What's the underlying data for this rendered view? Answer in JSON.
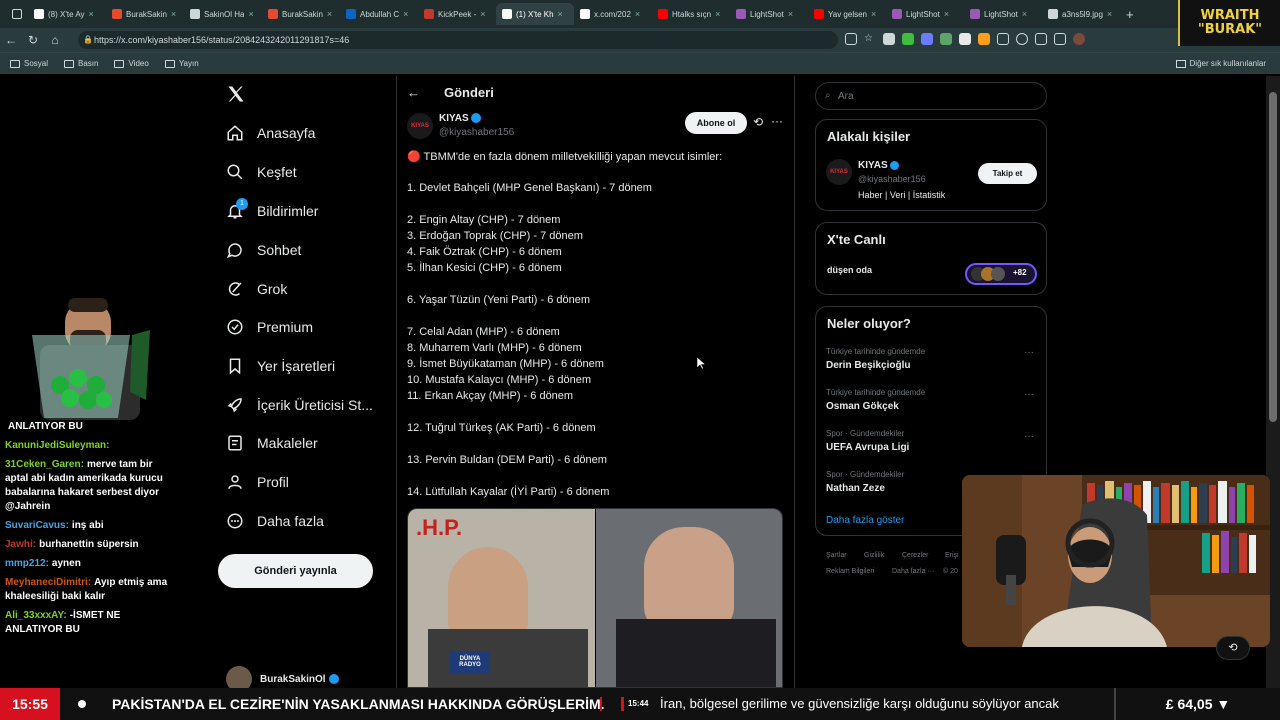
{
  "browser": {
    "tabs": [
      {
        "label": "(8) X'te Ay",
        "color": "#ffffff"
      },
      {
        "label": "BurakSakin",
        "color": "#e64a2e"
      },
      {
        "label": "SakinOl Ha",
        "color": "#cfd8d8"
      },
      {
        "label": "BurakSakin",
        "color": "#e64a2e"
      },
      {
        "label": "Abdullah C",
        "color": "#0a66c2"
      },
      {
        "label": "KickPeek -",
        "color": "#c0392b"
      },
      {
        "label": "(1) X'te Kh",
        "color": "#ffffff"
      },
      {
        "label": "x.com/202",
        "color": "#ffffff"
      },
      {
        "label": "Htalks sıçn",
        "color": "#ff0000"
      },
      {
        "label": "LightShot",
        "color": "#9b59b6"
      },
      {
        "label": "Yav gelsen",
        "color": "#ff0000"
      },
      {
        "label": "LightShot",
        "color": "#9b59b6"
      },
      {
        "label": "LightShot",
        "color": "#9b59b6"
      },
      {
        "label": "a3ns5l9.jpg",
        "color": "#cfd8d8"
      }
    ],
    "url": "https://x.com/kiyashaber156/status/2084243242011291817s=46",
    "bookmarks": [
      "Sosyal",
      "Basın",
      "Video",
      "Yayın"
    ],
    "other_bookmarks": "Diğer sık kullanılanlar"
  },
  "overlay": {
    "badge_line1": "WRAITH",
    "badge_line2": "\"BURAK\"",
    "chat": [
      {
        "user": "",
        "text": "ANLATIYOR BU",
        "color": "#ffffff"
      },
      {
        "user": "KanuniJediSuleyman:",
        "text": "",
        "color": "#7ed321"
      },
      {
        "user": "31Ceken_Garen:",
        "text": "merve tam bir aptal abi kadın amerikada kurucu babalarına hakaret serbest diyor @Jahrein",
        "color": "#7ed321"
      },
      {
        "user": "SuvariCavus:",
        "text": "inş abi",
        "color": "#4aa3df"
      },
      {
        "user": "Jawhi:",
        "text": "burhanettin süpersin",
        "color": "#c0392b"
      },
      {
        "user": "mmp212:",
        "text": "aynen",
        "color": "#4aa3df"
      },
      {
        "user": "MeyhaneciDimitri:",
        "text": "Ayıp etmiş ama khaleesiliği baki kalır",
        "color": "#d35400"
      },
      {
        "user": "Ali_33xxxAY:",
        "text": "-İSMET NE ANLATIYOR BU",
        "color": "#7ed321"
      }
    ],
    "ticker_time": "15:55",
    "ticker_main": "PAKİSTAN'DA EL CEZİRE'NİN YASAKLANMASI HAKKINDA GÖRÜŞLERİM.",
    "ticker_time2": "15:44",
    "ticker_sub": "İran, bölgesel gerilime ve güvensizliğe karşı olduğunu söylüyor ancak",
    "stock": "£ 64,05 ▼"
  },
  "x": {
    "nav": [
      "Anasayfa",
      "Keşfet",
      "Bildirimler",
      "Sohbet",
      "Grok",
      "Premium",
      "Yer İşaretleri",
      "İçerik Üreticisi St...",
      "Makaleler",
      "Profil",
      "Daha fazla"
    ],
    "notif_count": "1",
    "post_button": "Gönderi yayınla",
    "account_name": "BurakSakinOl",
    "header_title": "Gönderi",
    "author_name": "KIYAS",
    "author_handle": "@kiyashaber156",
    "avatar_text": "KIYAS",
    "subscribe": "Abone ol",
    "tweet_lines": [
      "🔴 TBMM'de en fazla dönem milletvekilliği yapan mevcut isimler:",
      "1. Devlet Bahçeli (MHP Genel Başkanı) - 7 dönem",
      "2. Engin Altay (CHP) - 7 dönem",
      "3. Erdoğan Toprak (CHP) - 7 dönem",
      "4. Faik Öztrak (CHP) - 6 dönem",
      "5. İlhan Kesici (CHP) - 6 dönem",
      "6. Yaşar Tüzün (Yeni Parti) - 6 dönem",
      "7. Celal Adan (MHP) - 6 dönem",
      "8. Muharrem Varlı (MHP) - 6 dönem",
      "9. İsmet Büyükataman (MHP) - 6 dönem",
      "10. Mustafa Kalaycı (MHP) - 6 dönem",
      "11. Erkan Akçay (MHP) - 6 dönem",
      "12. Tuğrul Türkeş (AK Parti) - 6 dönem",
      "13. Pervin Buldan (DEM Parti) - 6 dönem",
      "14. Lütfullah Kayalar (İYİ Parti) - 6 dönem"
    ],
    "image_text_left": ".H.P.",
    "image_text_mic": "DÜNYA RADYO",
    "search_placeholder": "Ara",
    "related_title": "Alakalı kişiler",
    "related_name": "KIYAS",
    "related_handle": "@kiyashaber156",
    "related_bio": "Haber | Veri | İstatistik",
    "follow": "Takip et",
    "live_title": "X'te Canlı",
    "live_room": "düşen oda",
    "live_count": "+82",
    "trends_title": "Neler oluyor?",
    "trends": [
      {
        "category": "Türkiye tarihinde gündemde",
        "name": "Derin Beşikçioğlu"
      },
      {
        "category": "Türkiye tarihinde gündemde",
        "name": "Osman Gökçek"
      },
      {
        "category": "Spor · Gündemdekiler",
        "name": "UEFA Avrupa Ligi"
      },
      {
        "category": "Spor · Gündemdekiler",
        "name": "Nathan Zeze"
      }
    ],
    "show_more": "Daha fazla göster",
    "footer": [
      "Şartlar",
      "Gizlilik",
      "Çerezler",
      "Erişi",
      "Reklam Bilgileri",
      "Daha fazla ···",
      "© 20"
    ]
  },
  "colors": {
    "accent": "#1d9bf0",
    "background": "#000000",
    "text": "#e7e9ea",
    "muted": "#71767b",
    "border": "#2f3336",
    "ticker_red": "#d6101e"
  }
}
